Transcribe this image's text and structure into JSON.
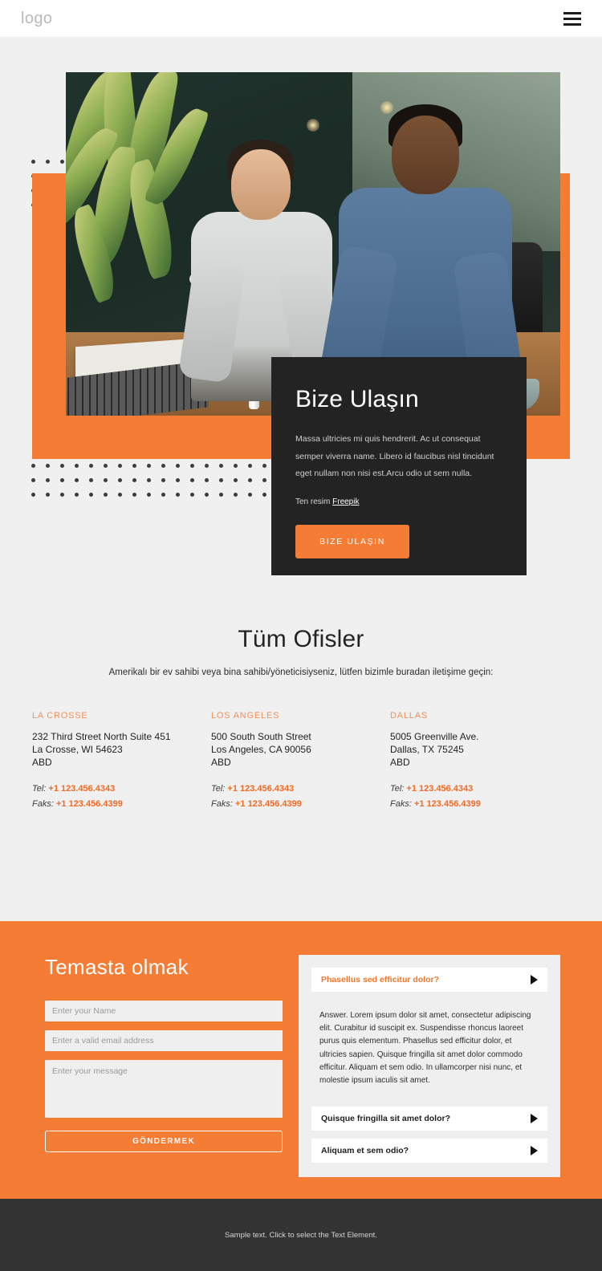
{
  "header": {
    "logo": "logo",
    "menu_icon": "hamburger-icon"
  },
  "hero": {
    "card": {
      "title": "Bize Ulaşın",
      "body": "Massa ultricies mi quis hendrerit. Ac ut consequat semper viverra name. Libero id faucibus nisl tincidunt eget nullam non nisi est.Arcu odio ut sem nulla.",
      "credit_prefix": "Ten resim ",
      "credit_link": "Freepik",
      "cta_label": "BIZE ULAŞIN"
    },
    "accent_color": "#f47c35",
    "card_color": "#232323"
  },
  "offices": {
    "title": "Tüm Ofisler",
    "subtitle": "Amerikalı bir ev sahibi veya bina sahibi/yöneticisiyseniz, lütfen bizimle buradan iletişime geçin:",
    "tel_label": "Tel:",
    "fax_label": "Faks:",
    "items": [
      {
        "name": "LA CROSSE",
        "address": "232 Third Street North Suite 451\nLa Crosse, WI 54623\nABD",
        "tel": "+1 123.456.4343",
        "fax": "+1 123.456.4399"
      },
      {
        "name": "LOS ANGELES",
        "address": "500 South South Street\nLos Angeles, CA 90056\nABD",
        "tel": "+1 123.456.4343",
        "fax": "+1 123.456.4399"
      },
      {
        "name": "DALLAS",
        "address": "5005 Greenville Ave.\nDallas, TX 75245\nABD",
        "tel": "+1 123.456.4343",
        "fax": "+1 123.456.4399"
      }
    ]
  },
  "contact": {
    "title": "Temasta olmak",
    "name_placeholder": "Enter your Name",
    "name_value": "",
    "email_placeholder": "Enter a valid email address",
    "email_value": "",
    "message_placeholder": "Enter your message",
    "message_value": "",
    "submit_label": "GÖNDERMEK"
  },
  "faq": {
    "items": [
      {
        "question": "Phasellus sed efficitur dolor?",
        "answer": "Answer. Lorem ipsum dolor sit amet, consectetur adipiscing elit. Curabitur id suscipit ex. Suspendisse rhoncus laoreet purus quis elementum. Phasellus sed efficitur dolor, et ultricies sapien. Quisque fringilla sit amet dolor commodo efficitur. Aliquam et sem odio. In ullamcorper nisi nunc, et molestie ipsum iaculis sit amet.",
        "open": true
      },
      {
        "question": "Quisque fringilla sit amet dolor?",
        "answer": "",
        "open": false
      },
      {
        "question": "Aliquam et sem odio?",
        "answer": "",
        "open": false
      }
    ]
  },
  "footer": {
    "text": "Sample text. Click to select the Text Element."
  }
}
